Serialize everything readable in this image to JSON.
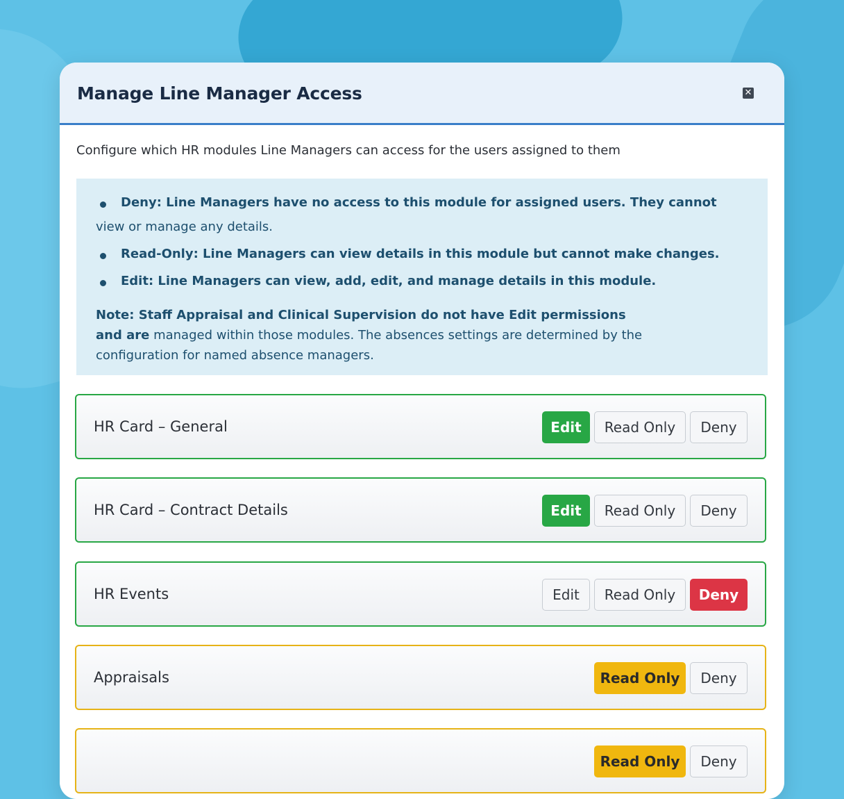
{
  "modal": {
    "title": "Manage Line Manager Access",
    "close_icon": "close-icon",
    "intro": "Configure which HR modules Line Managers can access for the users assigned to them"
  },
  "info": {
    "deny_line1": "Deny: Line Managers have no access to this module for assigned users. They cannot",
    "deny_line2": "view or manage any details.",
    "read_only": "Read-Only: Line Managers can view details in this module but cannot make changes.",
    "edit": "Edit: Line Managers can view, add, edit, and manage details in this module.",
    "note_bold": "Note: Staff Appraisal and Clinical Supervision do not have Edit permissions and are",
    "note_rest": "managed within those modules. The absences settings are determined by the configuration for named absence managers."
  },
  "modules": [
    {
      "label": "HR Card – General",
      "options": [
        "Edit",
        "Read Only",
        "Deny"
      ],
      "selected": "Edit"
    },
    {
      "label": "HR Card – Contract Details",
      "options": [
        "Edit",
        "Read Only",
        "Deny"
      ],
      "selected": "Edit"
    },
    {
      "label": "HR Events",
      "options": [
        "Edit",
        "Read Only",
        "Deny"
      ],
      "selected": "Deny"
    },
    {
      "label": "Appraisals",
      "options": [
        "Read Only",
        "Deny"
      ],
      "selected": "Read Only"
    },
    {
      "label": "",
      "options": [
        "Read Only",
        "Deny"
      ],
      "selected": "Read Only"
    }
  ],
  "colors": {
    "edit": "#28a745",
    "deny": "#dc3545",
    "read_only": "#f0b70f",
    "header_accent": "#3a7ec9"
  }
}
